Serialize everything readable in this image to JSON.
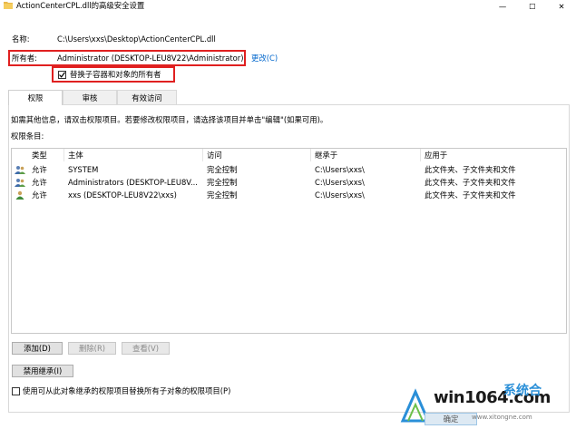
{
  "window": {
    "title": "ActionCenterCPL.dll的高级安全设置",
    "controls": {
      "minimize": "—",
      "maximize": "☐",
      "close": "✕"
    }
  },
  "name": {
    "label": "名称:",
    "value": "C:\\Users\\xxs\\Desktop\\ActionCenterCPL.dll"
  },
  "owner": {
    "label": "所有者:",
    "value": "Administrator (DESKTOP-LEU8V22\\Administrator)",
    "change_link": "更改(C)"
  },
  "replace_owner": {
    "label": "替换子容器和对象的所有者",
    "checked": true
  },
  "tabs": [
    {
      "label": "权限",
      "active": true
    },
    {
      "label": "审核",
      "active": false
    },
    {
      "label": "有效访问",
      "active": false
    }
  ],
  "info_text": "如需其他信息，请双击权限项目。若要修改权限项目，请选择该项目并单击\"编辑\"(如果可用)。",
  "entries_label": "权限条目:",
  "table": {
    "columns": [
      "类型",
      "主体",
      "访问",
      "继承于",
      "应用于"
    ],
    "rows": [
      {
        "icon": "user-group-icon",
        "type": "允许",
        "principal": "SYSTEM",
        "access": "完全控制",
        "inherited_from": "C:\\Users\\xxs\\",
        "applies_to": "此文件夹、子文件夹和文件"
      },
      {
        "icon": "user-group-icon",
        "type": "允许",
        "principal": "Administrators (DESKTOP-LEU8V...",
        "access": "完全控制",
        "inherited_from": "C:\\Users\\xxs\\",
        "applies_to": "此文件夹、子文件夹和文件"
      },
      {
        "icon": "user-icon",
        "type": "允许",
        "principal": "xxs (DESKTOP-LEU8V22\\xxs)",
        "access": "完全控制",
        "inherited_from": "C:\\Users\\xxs\\",
        "applies_to": "此文件夹、子文件夹和文件"
      }
    ]
  },
  "buttons": {
    "add": "添加(D)",
    "remove": "删除(R)",
    "view": "查看(V)",
    "disable_inheritance": "禁用继承(I)"
  },
  "replace_child": {
    "label": "使用可从此对象继承的权限项目替换所有子对象的权限项目(P)",
    "checked": false
  },
  "partial_button": "确定",
  "watermark": {
    "site": "win1064.com",
    "brand": "系统合",
    "url": "www.xitongne.com"
  },
  "colors": {
    "highlight": "#e02020",
    "link": "#0066cc",
    "brand": "#2a8fd8"
  }
}
